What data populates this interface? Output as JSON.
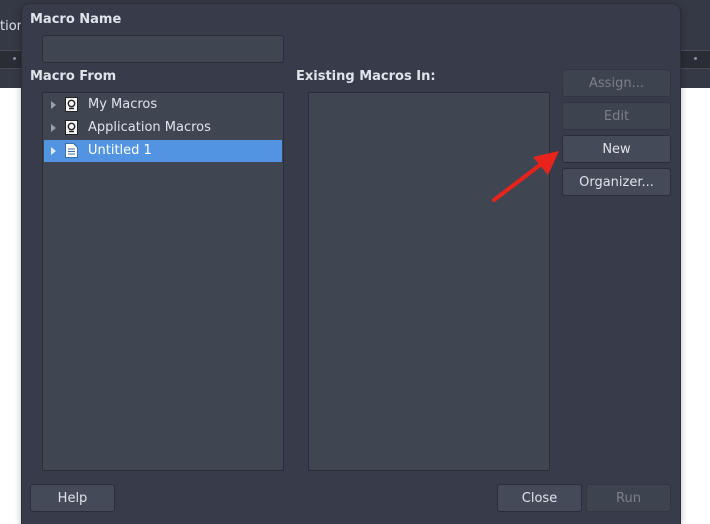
{
  "background": {
    "title_fragment": "tion"
  },
  "dialog": {
    "macro_name_label": "Macro Name",
    "macro_name_value": "",
    "macro_from_label": "Macro From",
    "existing_macros_label": "Existing Macros In:",
    "tree": [
      {
        "label": "My Macros",
        "icon": "macro-library-icon",
        "selected": false
      },
      {
        "label": "Application Macros",
        "icon": "macro-library-icon",
        "selected": false
      },
      {
        "label": "Untitled 1",
        "icon": "document-icon",
        "selected": true
      }
    ],
    "existing_macros": [],
    "buttons": {
      "assign": "Assign...",
      "edit": "Edit",
      "new": "New",
      "organizer": "Organizer...",
      "help": "Help",
      "close": "Close",
      "run": "Run"
    },
    "accent_color": "#5294e2",
    "annotation_arrow_color": "#e8231c"
  }
}
